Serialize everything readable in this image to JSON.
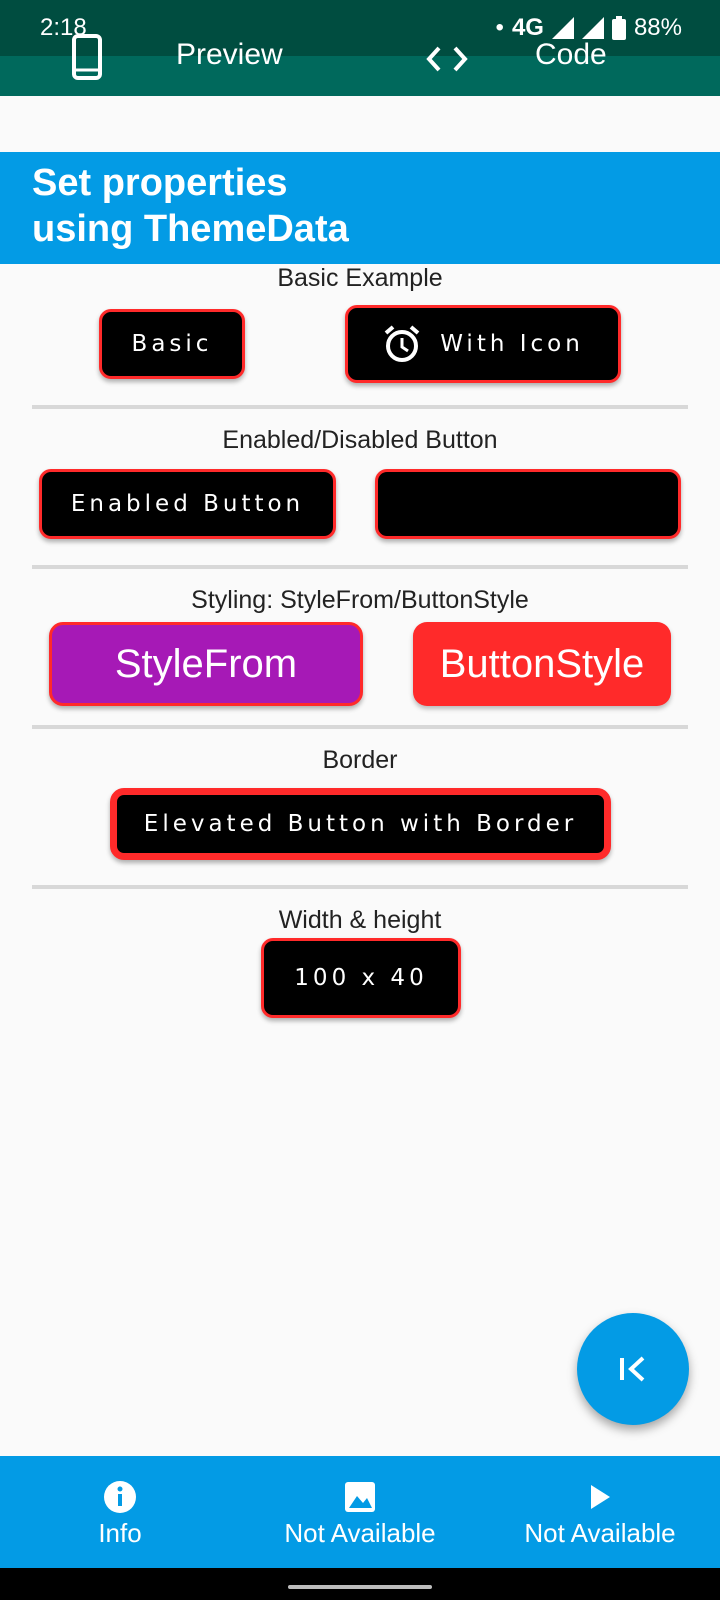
{
  "status_bar": {
    "time": "2:18",
    "network": "4G",
    "battery": "88%"
  },
  "tabs": [
    {
      "label": "Preview",
      "icon": "phone-icon"
    },
    {
      "label": "Code",
      "icon": "code-icon"
    }
  ],
  "header": {
    "title_line1": "Set properties",
    "title_line2": "using ThemeData"
  },
  "sections": {
    "basic": {
      "title": "Basic Example",
      "basic_label": "Basic",
      "with_icon_label": "With Icon",
      "icon": "alarm-icon"
    },
    "enabled": {
      "title": "Enabled/Disabled Button",
      "enabled_label": "Enabled Button",
      "disabled_label": ""
    },
    "styling": {
      "title": "Styling: StyleFrom/ButtonStyle",
      "stylefrom_label": "StyleFrom",
      "buttonstyle_label": "ButtonStyle"
    },
    "border": {
      "title": "Border",
      "button_label": "Elevated Button with Border"
    },
    "size": {
      "title": "Width & height",
      "button_label": "100 x 40"
    }
  },
  "fab": {
    "icon": "first-page-icon"
  },
  "bottom_nav": [
    {
      "label": "Info",
      "icon": "info-icon"
    },
    {
      "label": "Not Available",
      "icon": "image-icon"
    },
    {
      "label": "Not Available",
      "icon": "play-icon"
    }
  ],
  "colors": {
    "status_bar": "#004d40",
    "app_bar": "#00695c",
    "accent": "#039be5",
    "button_border": "#ff2a2a",
    "stylefrom_bg": "#a619b6",
    "buttonstyle_bg": "#ff2a2a"
  }
}
